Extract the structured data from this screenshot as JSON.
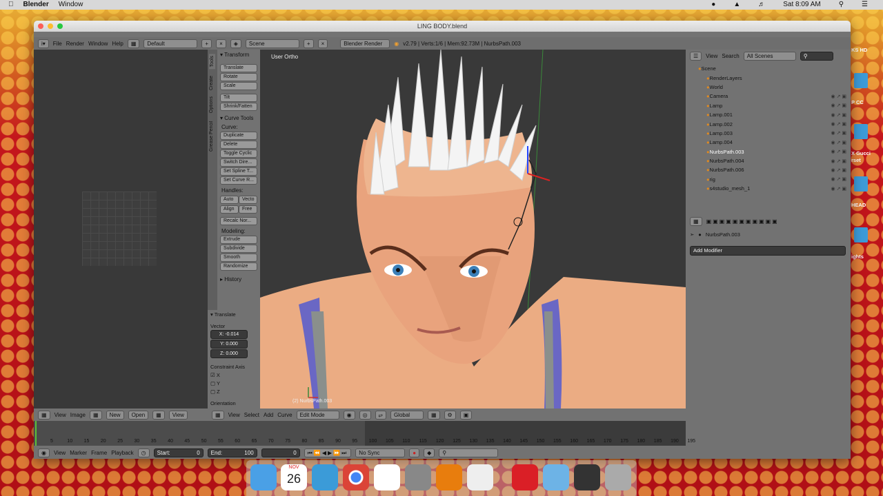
{
  "menubar": {
    "app": "Blender",
    "menu": "Window",
    "time": "Sat 8:09 AM"
  },
  "window": {
    "title": "LING BODY.blend"
  },
  "info": {
    "menus": [
      "File",
      "Render",
      "Window",
      "Help"
    ],
    "layout": "Default",
    "scene": "Scene",
    "engine": "Blender Render",
    "stats": "v2.79 | Verts:1/6 | Mem:92.73M | NurbsPath.003"
  },
  "toolshelf": {
    "tabs": [
      "Tools",
      "Create",
      "Options",
      "Grease Pencil"
    ],
    "transform_title": "Transform",
    "transform": [
      "Translate",
      "Rotate",
      "Scale",
      "Tilt",
      "Shrink/Fatten"
    ],
    "curve_tools_title": "Curve Tools",
    "curve_label": "Curve:",
    "curve": [
      "Duplicate",
      "Delete",
      "Toggle Cyclic",
      "Switch Dire...",
      "Set Spline T...",
      "Set Curve R..."
    ],
    "handles_label": "Handles:",
    "handles": [
      "Auto",
      "Vecto",
      "Align",
      "Free"
    ],
    "recalc": "Recalc Nor...",
    "modeling_label": "Modeling:",
    "modeling": [
      "Extrude",
      "Subdivide",
      "Smooth",
      "Randomize"
    ],
    "history": "History"
  },
  "operator": {
    "title": "Translate",
    "vector_label": "Vector",
    "x": "X: -0.014",
    "y": "Y: 0.000",
    "z": "Z: 0.000",
    "constraint": "Constraint Axis",
    "axes": [
      "X",
      "Y",
      "Z"
    ],
    "orientation": "Orientation"
  },
  "viewport": {
    "label": "User Ortho",
    "object": "(2) NurbsPath.003",
    "menus": [
      "View",
      "Select",
      "Add",
      "Curve"
    ],
    "mode": "Edit Mode",
    "orientation": "Global"
  },
  "image_editor": {
    "menus": [
      "View",
      "Image"
    ],
    "new": "New",
    "open": "Open",
    "view": "View"
  },
  "outliner": {
    "menus": [
      "View",
      "Search"
    ],
    "filter": "All Scenes",
    "items": [
      "Scene",
      "RenderLayers",
      "World",
      "Camera",
      "Lamp",
      "Lamp.001",
      "Lamp.002",
      "Lamp.003",
      "Lamp.004",
      "NurbsPath.003",
      "NurbsPath.004",
      "NurbsPath.006",
      "rig",
      "s4studio_mesh_1"
    ]
  },
  "properties": {
    "object": "NurbsPath.003",
    "add_modifier": "Add Modifier"
  },
  "timeline": {
    "ticks": [
      "5",
      "10",
      "15",
      "20",
      "25",
      "30",
      "35",
      "40",
      "45",
      "50",
      "55",
      "60",
      "65",
      "70",
      "75",
      "80",
      "85",
      "90",
      "95",
      "100",
      "105",
      "110",
      "115",
      "120",
      "125",
      "130",
      "135",
      "140",
      "145",
      "150",
      "155",
      "160",
      "165",
      "170",
      "175",
      "180",
      "185",
      "190",
      "195"
    ],
    "menus": [
      "View",
      "Marker",
      "Frame",
      "Playback"
    ],
    "start_label": "Start:",
    "start": "0",
    "end_label": "End:",
    "end": "100",
    "current": "0",
    "sync": "No Sync"
  },
  "desktop_labels": [
    "KS HD",
    "P CC",
    "X Gucci",
    "rset",
    "HEAD",
    "ights"
  ],
  "dock": {
    "calendar_month": "NOV",
    "calendar_day": "26"
  },
  "colors": {
    "bg": "#737373",
    "viewport": "#393939",
    "skin": "#e9a37d",
    "hair": "#f4f4f4"
  }
}
